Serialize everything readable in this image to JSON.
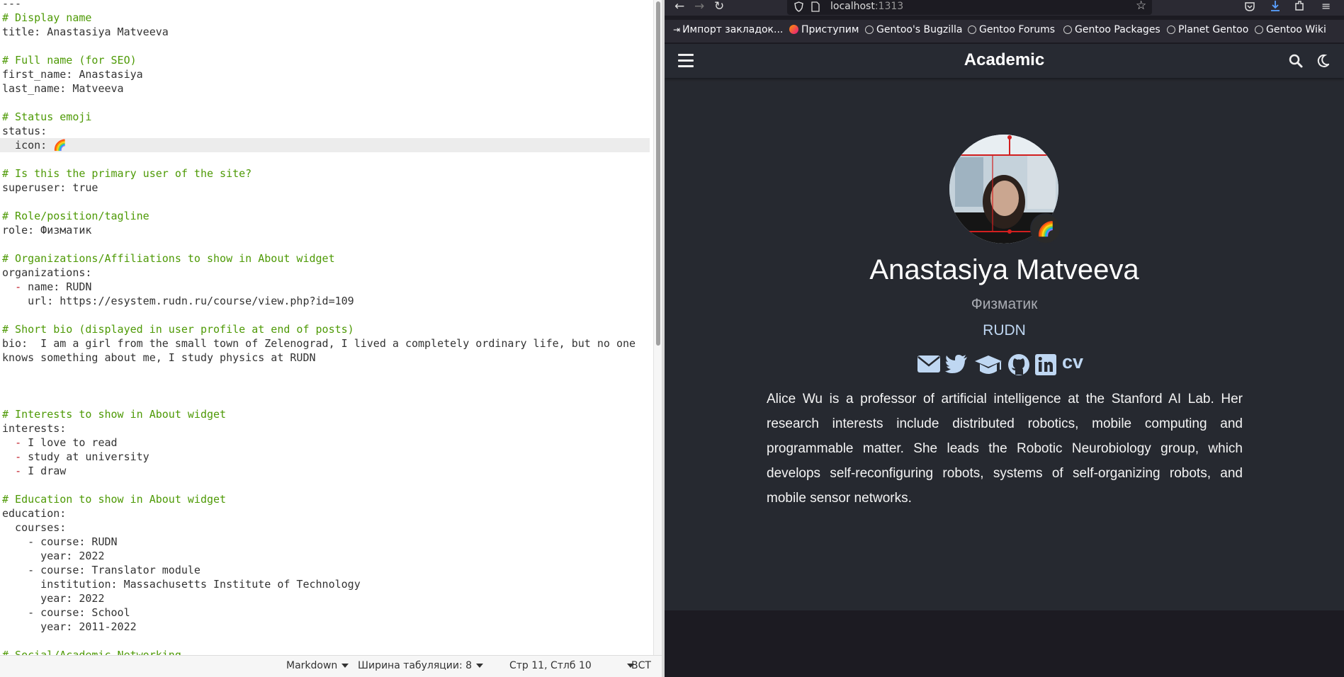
{
  "editor": {
    "lines": [
      {
        "text": "---",
        "kind": "normal",
        "highlighted": false
      },
      {
        "text": "# Display name",
        "kind": "comment",
        "highlighted": false
      },
      {
        "text": "title: Anastasiya Matveeva",
        "kind": "normal",
        "highlighted": false
      },
      {
        "text": "",
        "kind": "normal",
        "highlighted": false
      },
      {
        "text": "# Full name (for SEO)",
        "kind": "comment",
        "highlighted": false
      },
      {
        "text": "first_name: Anastasiya",
        "kind": "normal",
        "highlighted": false
      },
      {
        "text": "last_name: Matveeva",
        "kind": "normal",
        "highlighted": false
      },
      {
        "text": "",
        "kind": "normal",
        "highlighted": false
      },
      {
        "text": "# Status emoji",
        "kind": "comment",
        "highlighted": false
      },
      {
        "text": "status:",
        "kind": "normal",
        "highlighted": false
      },
      {
        "text": "  icon: 🌈",
        "kind": "normal",
        "highlighted": true
      },
      {
        "text": "",
        "kind": "normal",
        "highlighted": false
      },
      {
        "text": "# Is this the primary user of the site?",
        "kind": "comment",
        "highlighted": false
      },
      {
        "text": "superuser: true",
        "kind": "normal",
        "highlighted": false
      },
      {
        "text": "",
        "kind": "normal",
        "highlighted": false
      },
      {
        "text": "# Role/position/tagline",
        "kind": "comment",
        "highlighted": false
      },
      {
        "text": "role: Физматик",
        "kind": "normal",
        "highlighted": false
      },
      {
        "text": "",
        "kind": "normal",
        "highlighted": false
      },
      {
        "text": "# Organizations/Affiliations to show in About widget",
        "kind": "comment",
        "highlighted": false
      },
      {
        "text": "organizations:",
        "kind": "normal",
        "highlighted": false
      },
      {
        "text": "name: RUDN",
        "kind": "dash",
        "indent": "  ",
        "highlighted": false
      },
      {
        "text": "    url: https://esystem.rudn.ru/course/view.php?id=109",
        "kind": "normal",
        "highlighted": false
      },
      {
        "text": "",
        "kind": "normal",
        "highlighted": false
      },
      {
        "text": "# Short bio (displayed in user profile at end of posts)",
        "kind": "comment",
        "highlighted": false
      },
      {
        "text": "bio:  I am a girl from the small town of Zelenograd, I lived a completely ordinary life, but no one",
        "kind": "normal",
        "highlighted": false
      },
      {
        "text": "knows something about me, I study physics at RUDN",
        "kind": "normal",
        "highlighted": false
      },
      {
        "text": "",
        "kind": "normal",
        "highlighted": false
      },
      {
        "text": "",
        "kind": "normal",
        "highlighted": false
      },
      {
        "text": "",
        "kind": "normal",
        "highlighted": false
      },
      {
        "text": "# Interests to show in About widget",
        "kind": "comment",
        "highlighted": false
      },
      {
        "text": "interests:",
        "kind": "normal",
        "highlighted": false
      },
      {
        "text": "I love to read",
        "kind": "dash",
        "indent": "  ",
        "highlighted": false
      },
      {
        "text": "study at university",
        "kind": "dash",
        "indent": "  ",
        "highlighted": false
      },
      {
        "text": "I draw",
        "kind": "dash",
        "indent": "  ",
        "highlighted": false
      },
      {
        "text": "",
        "kind": "normal",
        "highlighted": false
      },
      {
        "text": "# Education to show in About widget",
        "kind": "comment",
        "highlighted": false
      },
      {
        "text": "education:",
        "kind": "normal",
        "highlighted": false
      },
      {
        "text": "  courses:",
        "kind": "normal",
        "highlighted": false
      },
      {
        "text": "    - course: RUDN",
        "kind": "normal",
        "highlighted": false
      },
      {
        "text": "      year: 2022",
        "kind": "normal",
        "highlighted": false
      },
      {
        "text": "    - course: Translator module",
        "kind": "normal",
        "highlighted": false
      },
      {
        "text": "      institution: Massachusetts Institute of Technology",
        "kind": "normal",
        "highlighted": false
      },
      {
        "text": "      year: 2022",
        "kind": "normal",
        "highlighted": false
      },
      {
        "text": "    - course: School",
        "kind": "normal",
        "highlighted": false
      },
      {
        "text": "      year: 2011-2022",
        "kind": "normal",
        "highlighted": false
      },
      {
        "text": "",
        "kind": "normal",
        "highlighted": false
      },
      {
        "text": "# Social/Academic Networking",
        "kind": "comment",
        "highlighted": false
      }
    ],
    "status_bar": {
      "language": "Markdown",
      "tab_width": "Ширина табуляции: 8",
      "cursor_position": "Стр 11, Стлб 10",
      "insert_mode": "ВСТ"
    }
  },
  "browser": {
    "url_host": "localhost",
    "url_port": ":1313",
    "bookmarks": [
      {
        "label": "Импорт закладок...",
        "icon": "import-icon"
      },
      {
        "label": "Приступим",
        "icon": "firefox-icon"
      },
      {
        "label": "Gentoo's Bugzilla",
        "icon": "globe-icon"
      },
      {
        "label": "Gentoo Forums",
        "icon": "globe-icon"
      },
      {
        "label": "Gentoo Packages",
        "icon": "globe-icon"
      },
      {
        "label": "Planet Gentoo",
        "icon": "globe-icon"
      },
      {
        "label": "Gentoo Wiki",
        "icon": "globe-icon"
      }
    ]
  },
  "site": {
    "title": "Academic",
    "status_emoji": "🌈",
    "name": "Anastasiya Matveeva",
    "role": "Физматик",
    "organization": "RUDN",
    "social_icons": [
      "envelope-icon",
      "twitter-icon",
      "graduation-cap-icon",
      "github-icon",
      "linkedin-icon",
      "cv-icon"
    ],
    "cv_label": "cv",
    "bio": "Alice Wu is a professor of artificial intelligence at the Stanford AI Lab. Her research interests include distributed robotics, mobile computing and programmable matter. She leads the Robotic Neurobiology group, which develops self-reconfiguring robots, systems of self-organizing robots, and mobile sensor networks."
  },
  "colors": {
    "comment": "#4e9a06",
    "list_dash": "#c01c28",
    "site_background": "#262930",
    "site_link": "#bfd7f2"
  }
}
